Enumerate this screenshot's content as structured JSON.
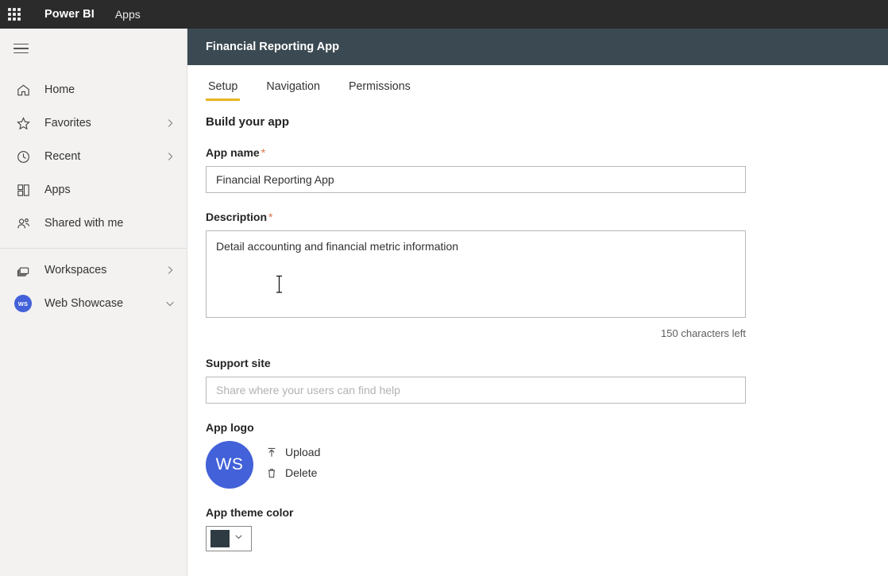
{
  "topbar": {
    "waffle_icon": "app-launcher-icon",
    "brand": "Power BI",
    "section_link": "Apps"
  },
  "sidebar": {
    "menu_icon": "hamburger-icon",
    "items": [
      {
        "label": "Home",
        "icon": "home-icon",
        "chevron": "none"
      },
      {
        "label": "Favorites",
        "icon": "star-icon",
        "chevron": "right"
      },
      {
        "label": "Recent",
        "icon": "clock-icon",
        "chevron": "right"
      },
      {
        "label": "Apps",
        "icon": "apps-grid-icon",
        "chevron": "none"
      },
      {
        "label": "Shared with me",
        "icon": "people-share-icon",
        "chevron": "none"
      }
    ],
    "items_lower": [
      {
        "label": "Workspaces",
        "icon": "workspaces-icon",
        "chevron": "right"
      },
      {
        "label": "Web Showcase",
        "icon": "avatar",
        "chevron": "down",
        "initials": "WS"
      }
    ]
  },
  "apptitle": {
    "title": "Financial Reporting App"
  },
  "tabs": [
    {
      "label": "Setup",
      "active": true
    },
    {
      "label": "Navigation",
      "active": false
    },
    {
      "label": "Permissions",
      "active": false
    }
  ],
  "form": {
    "heading": "Build your app",
    "app_name": {
      "label": "App name",
      "required": "*",
      "value": "Financial Reporting App",
      "placeholder": ""
    },
    "description": {
      "label": "Description",
      "required": "*",
      "value": "Detail accounting and financial metric information",
      "placeholder": "",
      "counter": "150 characters left"
    },
    "support_site": {
      "label": "Support site",
      "value": "",
      "placeholder": "Share where your users can find help"
    },
    "app_logo": {
      "label": "App logo",
      "initials": "WS",
      "upload_label": "Upload",
      "upload_icon": "upload-icon",
      "delete_label": "Delete",
      "delete_icon": "trash-icon"
    },
    "theme_color": {
      "label": "App theme color",
      "value": "#2f3b42",
      "chevron_icon": "chevron-down-icon"
    }
  },
  "colors": {
    "topbar_bg": "#2b2b2b",
    "apptitle_bg": "#3b4a52",
    "sidebar_bg": "#f3f2f1",
    "accent_tab": "#e8b423",
    "avatar_blue": "#4361d8",
    "required_asterisk": "#e0704a"
  }
}
